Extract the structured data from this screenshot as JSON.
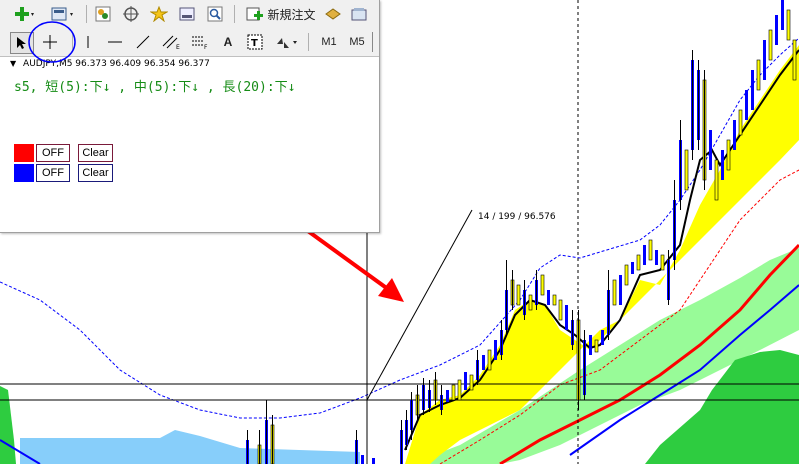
{
  "colors": {
    "yellow_band": "#ffff00",
    "green_band": "#98fb98",
    "cloud_blue": "#87cefa",
    "cloud_green": "#2ecc40",
    "bull_candle": "#ffff00",
    "bear_candle": "#0000ff",
    "red_line": "#ff0000",
    "blue_line": "#0000ff",
    "arrow": "#ff0000",
    "circle": "#0000ff"
  },
  "toolbar_top": {
    "new_order_label": "新規注文",
    "icons": [
      "new-chart-icon",
      "profiles-icon",
      "market-watch-icon",
      "navigator-icon",
      "favorites-icon",
      "terminal-icon",
      "zoom-icon",
      "new-order-icon",
      "strategy-tester-icon",
      "options-icon"
    ]
  },
  "toolbar_draw": {
    "cursor_icon": "arrow-cursor-icon",
    "crosshair_icon": "crosshair-icon",
    "text_label": "A",
    "timeframes": [
      "M1",
      "M5"
    ]
  },
  "chart_header": {
    "symbol_info": "AUDJPY,M5  96.373 96.409 96.354 96.377",
    "signal_text": "s5, 短(5):下↓ , 中(5):下↓ , 長(20):下↓"
  },
  "controls": [
    {
      "color": "#ff0000",
      "toggle_label": "OFF",
      "clear_label": "Clear"
    },
    {
      "color": "#0000ff",
      "toggle_label": "OFF",
      "clear_label": "Clear"
    }
  ],
  "crosshair_readout": "14 / 199 / 96.576"
}
